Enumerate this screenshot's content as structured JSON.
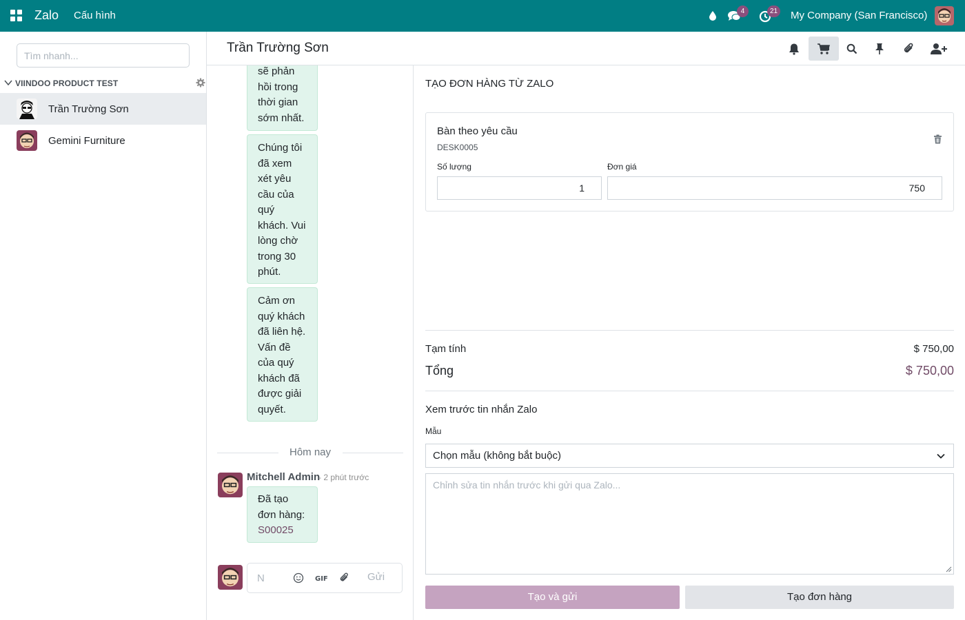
{
  "navbar": {
    "app_name": "Zalo",
    "menu_config": "Cấu hình",
    "messages_badge": "4",
    "activities_badge": "21",
    "company": "My Company (San Francisco)",
    "color": "#017e84"
  },
  "sidebar": {
    "search_placeholder": "Tìm nhanh...",
    "group_label": "VIINDOO PRODUCT TEST",
    "channels": [
      {
        "name": "Trần Trường Sơn",
        "active": true
      },
      {
        "name": "Gemini Furniture",
        "active": false
      }
    ]
  },
  "chat": {
    "title": "Trần Trường Sơn",
    "messages": [
      {
        "lines": [
          "sẽ phản",
          "hồi trong",
          "thời gian",
          "sớm nhất."
        ]
      },
      {
        "lines": [
          "Chúng tôi",
          "đã xem",
          "xét yêu",
          "cầu của",
          "quý",
          "khách. Vui",
          "lòng chờ",
          "trong 30",
          "phút."
        ]
      },
      {
        "lines": [
          "Cảm ơn",
          "quý khách",
          "đã liên hệ.",
          "Vấn đề",
          "của quý",
          "khách đã",
          "được giải",
          "quyết."
        ]
      }
    ],
    "day_separator": "Hôm nay",
    "last_author": "Mitchell Admin",
    "last_date": "- 2 phút trước",
    "last_lines": [
      "Đã tạo",
      "đơn hàng:"
    ],
    "last_order": "S00025",
    "composer_placeholder": "N",
    "send_label": "Gửi"
  },
  "order": {
    "title": "TẠO ĐƠN HÀNG TỪ ZALO",
    "product_name": "Bàn theo yêu cầu",
    "product_code": "DESK0005",
    "qty_label": "Số lượng",
    "qty_value": "1",
    "price_label": "Đơn giá",
    "price_value": "750",
    "subtotal_label": "Tạm tính",
    "subtotal_value": "$ 750,00",
    "total_label": "Tổng",
    "total_value": "$ 750,00",
    "preview_title": "Xem trước tin nhắn Zalo",
    "template_label": "Mẫu",
    "template_value": "Chọn mẫu (không bắt buộc)",
    "message_placeholder": "Chỉnh sửa tin nhắn trước khi gửi qua Zalo...",
    "btn_create_send": "Tạo và gửi",
    "btn_create": "Tạo đơn hàng"
  },
  "colors": {
    "accent": "#714b67",
    "bubble": "#e1f4ec",
    "primary_disabled": "#c5a3c0"
  }
}
